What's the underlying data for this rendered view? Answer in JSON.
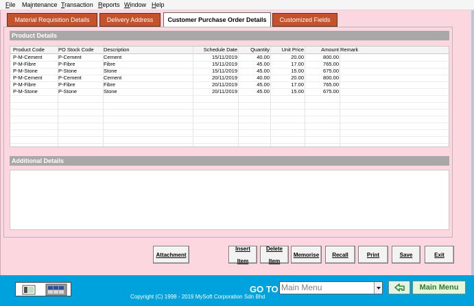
{
  "menu": [
    {
      "pre": "",
      "ul": "F",
      "post": "ile"
    },
    {
      "pre": "Ma",
      "ul": "i",
      "post": "ntenance"
    },
    {
      "pre": "",
      "ul": "T",
      "post": "ransaction"
    },
    {
      "pre": "",
      "ul": "R",
      "post": "eports"
    },
    {
      "pre": "",
      "ul": "W",
      "post": "indow"
    },
    {
      "pre": "",
      "ul": "H",
      "post": "elp"
    }
  ],
  "tabs": [
    {
      "label": "Material Requisition Details",
      "active": false
    },
    {
      "label": "Delivery Address",
      "active": false
    },
    {
      "label": "Customer Purchase Order Details",
      "active": true
    },
    {
      "label": "Customized Fields",
      "active": false
    }
  ],
  "sections": {
    "product": "Product  Details",
    "additional": "Additional Details"
  },
  "grid": {
    "columns": [
      "Product Code",
      "PO Stock Code",
      "Description",
      "Schedule Date",
      "Quantity",
      "Unit Price",
      "Amount",
      "Remark"
    ],
    "rows": [
      [
        "P-M-Cement",
        "P-Cement",
        "Cement",
        "15/11/2019",
        "40.00",
        "20.00",
        "800.00",
        ""
      ],
      [
        "P-M-Fibre",
        "P-Fibre",
        "Fibre",
        "15/11/2019",
        "45.00",
        "17.00",
        "765.00",
        ""
      ],
      [
        "P-M-Stone",
        "P-Stone",
        "Stone",
        "15/11/2019",
        "45.00",
        "15.00",
        "675.00",
        ""
      ],
      [
        "P-M-Cement",
        "P-Cement",
        "Cement",
        "20/11/2019",
        "40.00",
        "20.00",
        "800.00",
        ""
      ],
      [
        "P-M-Fibre",
        "P-Fibre",
        "Fibre",
        "20/11/2019",
        "45.00",
        "17.00",
        "765.00",
        ""
      ],
      [
        "P-M-Stone",
        "P-Stone",
        "Stone",
        "20/11/2019",
        "45.00",
        "15.00",
        "675.00",
        ""
      ]
    ]
  },
  "buttons": [
    {
      "name": "attachment-button",
      "line1": "Attachment",
      "line2": ""
    },
    {
      "name": "insert-item-button",
      "line1": "Insert",
      "line2": "Item"
    },
    {
      "name": "delete-item-button",
      "line1": "Delete",
      "line2": "Item"
    },
    {
      "name": "memorise-button",
      "line1": "Memorise",
      "line2": ""
    },
    {
      "name": "recall-button",
      "line1": "Recall",
      "line2": ""
    },
    {
      "name": "print-button",
      "line1": "Print",
      "line2": ""
    },
    {
      "name": "save-button",
      "line1": "Save",
      "line2": ""
    },
    {
      "name": "exit-button",
      "line1": "Exit",
      "line2": ""
    }
  ],
  "footer": {
    "goto_label": "GO TO",
    "menu_select": "Main Menu",
    "main_menu_button": "Main Menu",
    "copyright": "Copyright (C) 1998 - 2019 MySoft Corporation Sdn Bhd"
  },
  "icons": {
    "back": "back-arrow-icon",
    "dropdown": "chevron-down-icon",
    "window": "window-icon",
    "grid": "grid-view-icon"
  },
  "colors": {
    "tab": "#c4522c",
    "panel": "#fcd7e0",
    "footer": "#00a2de",
    "main_menu_text": "#2c7a2c"
  }
}
